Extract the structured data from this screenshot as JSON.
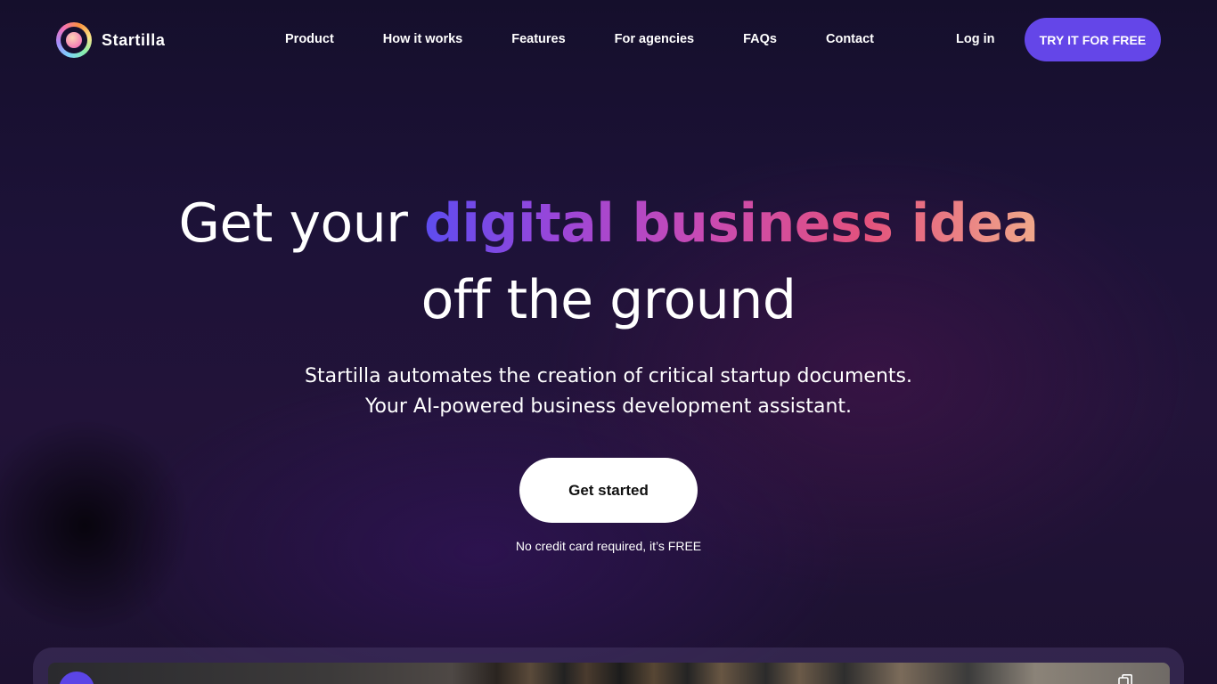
{
  "brand": {
    "name": "Startilla"
  },
  "nav": {
    "items": [
      {
        "label": "Product"
      },
      {
        "label": "How it works"
      },
      {
        "label": "Features"
      },
      {
        "label": "For agencies"
      },
      {
        "label": "FAQs"
      },
      {
        "label": "Contact"
      }
    ],
    "login_label": "Log in",
    "cta_label": "TRY IT FOR FREE"
  },
  "hero": {
    "title_before": "Get your ",
    "title_highlight": "digital business idea",
    "title_after": "off the ground",
    "subtitle_line1": "Startilla automates the creation of critical startup documents.",
    "subtitle_line2": "Your AI-powered business development assistant.",
    "cta_label": "Get started",
    "note": "No credit card required, it’s FREE"
  },
  "preview": {
    "icons": [
      "avatar",
      "copy-icon"
    ]
  },
  "colors": {
    "accent": "#6446e8",
    "background": "#1d1238",
    "gradient_start": "#5d4cf0",
    "gradient_end": "#f0a98a"
  }
}
